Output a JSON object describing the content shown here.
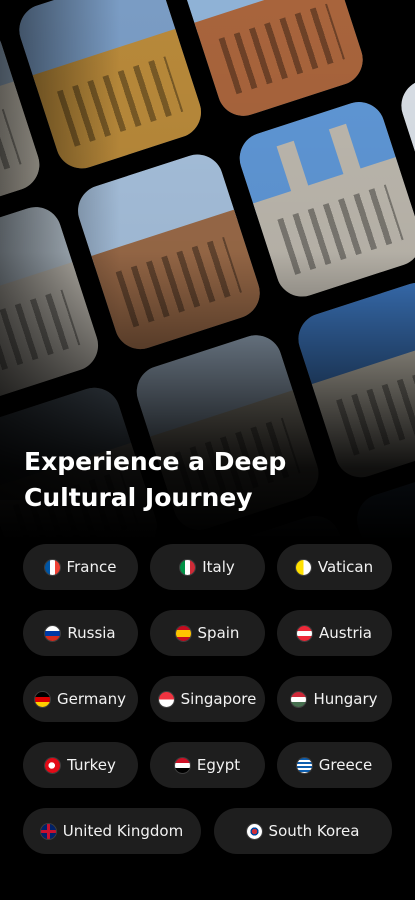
{
  "headline": "Experience a Deep Cultural Journey",
  "countries": [
    {
      "label": "France",
      "flag": "flag-france-icon"
    },
    {
      "label": "Italy",
      "flag": "flag-italy-icon"
    },
    {
      "label": "Vatican",
      "flag": "flag-vatican-icon"
    },
    {
      "label": "Russia",
      "flag": "flag-russia-icon"
    },
    {
      "label": "Spain",
      "flag": "flag-spain-icon"
    },
    {
      "label": "Austria",
      "flag": "flag-austria-icon"
    },
    {
      "label": "Germany",
      "flag": "flag-germany-icon"
    },
    {
      "label": "Singapore",
      "flag": "flag-singapore-icon"
    },
    {
      "label": "Hungary",
      "flag": "flag-hungary-icon"
    },
    {
      "label": "Turkey",
      "flag": "flag-turkey-icon"
    },
    {
      "label": "Egypt",
      "flag": "flag-egypt-icon"
    },
    {
      "label": "Greece",
      "flag": "flag-greece-icon"
    },
    {
      "label": "United Kingdom",
      "flag": "flag-united-kingdom-icon"
    },
    {
      "label": "South Korea",
      "flag": "flag-south-korea-icon"
    }
  ],
  "colors": {
    "background": "#000000",
    "chip": "#1e1e1e",
    "text": "#ffffff"
  }
}
